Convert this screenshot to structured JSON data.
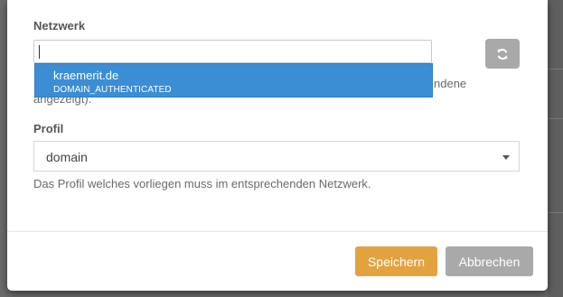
{
  "network": {
    "label": "Netzwerk",
    "input_value": "",
    "hint_partial_1": "ndene",
    "hint_partial_2": "angezeigt).",
    "refresh_icon": "refresh-icon"
  },
  "dropdown": {
    "item_name": "kraemerit.de",
    "item_status": "DOMAIN_AUTHENTICATED",
    "highlight_color": "#3b8ed4"
  },
  "profile": {
    "label": "Profil",
    "selected": "domain",
    "help": "Das Profil welches vorliegen muss im entsprechenden Netzwerk."
  },
  "footer": {
    "save_label": "Speichern",
    "cancel_label": "Abbrechen",
    "save_color": "#e2a33f",
    "cancel_color": "#a9a9a9"
  }
}
